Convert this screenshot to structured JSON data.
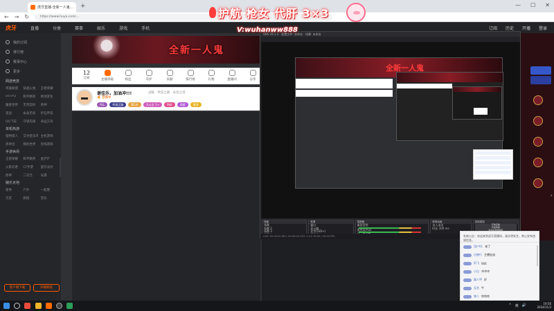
{
  "browser": {
    "tab_title": "虎牙直播-全新一人鬼...",
    "url": "https://www.huya.com/...",
    "new_tab": "+",
    "window_controls": [
      "—",
      "☐",
      "✕"
    ]
  },
  "site": {
    "logo": "虎牙",
    "nav": [
      "直播",
      "分类",
      "赛事",
      "娱乐",
      "游戏",
      "手机"
    ],
    "header_right": [
      "订阅",
      "历史",
      "开播",
      "登录"
    ]
  },
  "sidebar": {
    "top_items": [
      "我的订阅",
      "排行榜",
      "赛事中心",
      "更多"
    ],
    "sections": [
      {
        "title": "网游竞技",
        "items": [
          "英雄联盟",
          "穿越火线",
          "王者荣耀",
          "DOTA2",
          "和平精英",
          "绝地求生",
          "魔兽世界",
          "无畏契约",
          "原神",
          "逆战",
          "永劫无间",
          "炉石传说",
          "QQ飞车",
          "守望先锋",
          "命运方舟"
        ]
      },
      {
        "title": "单机热游",
        "items": [
          "怪物猎人",
          "艾尔登法环",
          "主机游戏",
          "黑神话",
          "我的世界",
          "恐怖游戏"
        ]
      },
      {
        "title": "手游休闲",
        "items": [
          "王者荣耀",
          "和平精英",
          "金铲铲",
          "火影忍者",
          "CF手游",
          "蛋仔派对",
          "原神",
          "二次元",
          "光遇"
        ]
      },
      {
        "title": "娱乐天地",
        "items": [
          "星秀",
          "户外",
          "一起看",
          "交友",
          "颜值",
          "音乐"
        ]
      }
    ],
    "buttons": [
      "客户端下载",
      "开播教程"
    ]
  },
  "room": {
    "banner_text": "全新一人鬼",
    "stats": [
      {
        "n": "12",
        "label": "订阅"
      },
      {
        "label": "主播等级"
      },
      {
        "label": "粉丝"
      },
      {
        "label": "守护"
      },
      {
        "label": "贡献"
      },
      {
        "label": "排行榜"
      },
      {
        "label": "礼物"
      },
      {
        "label": "直播间"
      },
      {
        "label": "分享"
      }
    ],
    "streamer_name": "谢佳乐，加油冲!!!",
    "streamer_sub": "战狼 · 传说之路 · 永恒之塔",
    "streamer_row2": "🔥 直播中",
    "badges": [
      {
        "text": "ALL",
        "color": "#9b59b6"
      },
      {
        "text": "传说之路",
        "color": "#3b3f8c"
      },
      {
        "text": "第1名",
        "color": "#e6a23c"
      },
      {
        "text": "大公主 1+",
        "color": "#d05fbd"
      },
      {
        "text": "特权",
        "color": "#e14b8a"
      },
      {
        "text": "周星",
        "color": "#b058d8"
      },
      {
        "text": "更多",
        "color": "#e8b425"
      }
    ]
  },
  "watermark": {
    "line1": "护航 枪女 代肝 3×3",
    "line2": "V:wuhanww888"
  },
  "obs": {
    "title": "OBS 29.1.3 - 配置文件: 未命名 - 场景: 未命名",
    "nested_text": "全新一人鬼",
    "panels": {
      "scenes": {
        "title": "场景",
        "rows": [
          "场景",
          "场景 2",
          "场景 3",
          "场景 4",
          "场景 5"
        ]
      },
      "sources": {
        "title": "来源",
        "rows": [
          "窗口",
          "显示器",
          "文字(GDI+)",
          "音频输入",
          "游戏采集"
        ]
      },
      "mixer": {
        "title": "混音器",
        "rows": [
          "桌面音频",
          "麦克风/Aux",
          "显示器采集"
        ]
      },
      "transitions": {
        "title": "转场动画",
        "rows": [
          "淡入淡出",
          "时长 300 ms"
        ]
      },
      "controls": {
        "title": "控制按钮",
        "rows": [
          "开始直播",
          "开始录制",
          "启动虚拟摄像机",
          "工作室模式",
          "设置",
          "退出"
        ]
      }
    },
    "status": "LIVE: 00:00:00   REC: 00:00:00   CPU: 2.1%   30.00 / 30.00 FPS"
  },
  "chat": {
    "notice": "系统公告：欢迎来到虎牙直播间，请文明发言，禁止发布违规信息。",
    "messages": [
      {
        "user": "用户01",
        "text": "来了"
      },
      {
        "user": "白夜行",
        "text": "主播加油"
      },
      {
        "user": "阿飞",
        "text": "666"
      },
      {
        "user": "小白",
        "text": "冲冲冲"
      },
      {
        "user": "路人甲",
        "text": "好"
      },
      {
        "user": "无名",
        "text": "牛"
      },
      {
        "user": "旅人",
        "text": "哈哈哈"
      },
      {
        "user": "大佬",
        "text": "送出 荧光棒"
      }
    ]
  },
  "taskbar": {
    "time": "19:56",
    "date": "2024/11/3",
    "tray": [
      "^",
      "英",
      "🔊"
    ]
  }
}
